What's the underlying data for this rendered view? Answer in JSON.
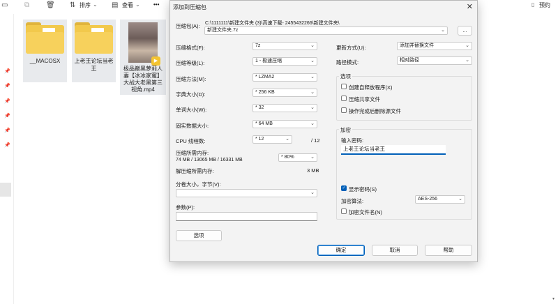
{
  "explorer": {
    "toolbar": {
      "sort_label": "排序",
      "view_label": "查看",
      "more_label": "•••",
      "preview_label": "预约"
    },
    "files": [
      {
        "name": "__MACOSX"
      },
      {
        "name": "上老王论坛当老王"
      },
      {
        "name": "极品巅黑萝莉人妻【冰冰家蜜】大战大老黑第三视角.mp4"
      }
    ]
  },
  "dialog": {
    "title": "添加到压缩包",
    "archive_label": "压缩包(A):",
    "archive_path": "C:\\1111111\\新建文件夹 (3)\\高速下载- 2455432266\\新建文件夹\\",
    "archive_name": "新建文件夹.7z",
    "browse_label": "...",
    "format_label": "压缩格式(F):",
    "format_value": "7z",
    "level_label": "压缩等级(L):",
    "level_value": "1 - 极速压缩",
    "method_label": "压缩方法(M):",
    "method_value": "* LZMA2",
    "dict_label": "字典大小(D):",
    "dict_value": "* 256 KB",
    "word_label": "单词大小(W):",
    "word_value": "* 32",
    "solid_label": "固实数据大小:",
    "solid_value": "* 64 MB",
    "threads_label": "CPU 线程数:",
    "threads_value": "* 12",
    "threads_max": "/ 12",
    "mem_label": "压缩所需内存:",
    "mem_detail": "74 MB / 13065 MB / 16331 MB",
    "mem_value": "* 80%",
    "decomp_label": "解压缩所需内存:",
    "decomp_value": "3 MB",
    "volume_label": "分卷大小，字节(V):",
    "volume_value": "",
    "params_label": "参数(P):",
    "params_value": "",
    "options_button": "选项",
    "update_label": "更新方式(U):",
    "update_value": "添加并替换文件",
    "pathmode_label": "路径模式:",
    "pathmode_value": "相对路径",
    "options_group": "选项",
    "opt_sfx": "创建自释放程序(X)",
    "opt_shared": "压缩共享文件",
    "opt_delete": "操作完成后删除源文件",
    "encrypt_group": "加密",
    "password_label": "输入密码:",
    "password_value": "上老王论坛当老王",
    "show_password": "显示密码(S)",
    "enc_method_label": "加密算法:",
    "enc_method_value": "AES-256",
    "enc_names": "加密文件名(N)",
    "ok": "确定",
    "cancel": "取消",
    "help": "帮助"
  }
}
